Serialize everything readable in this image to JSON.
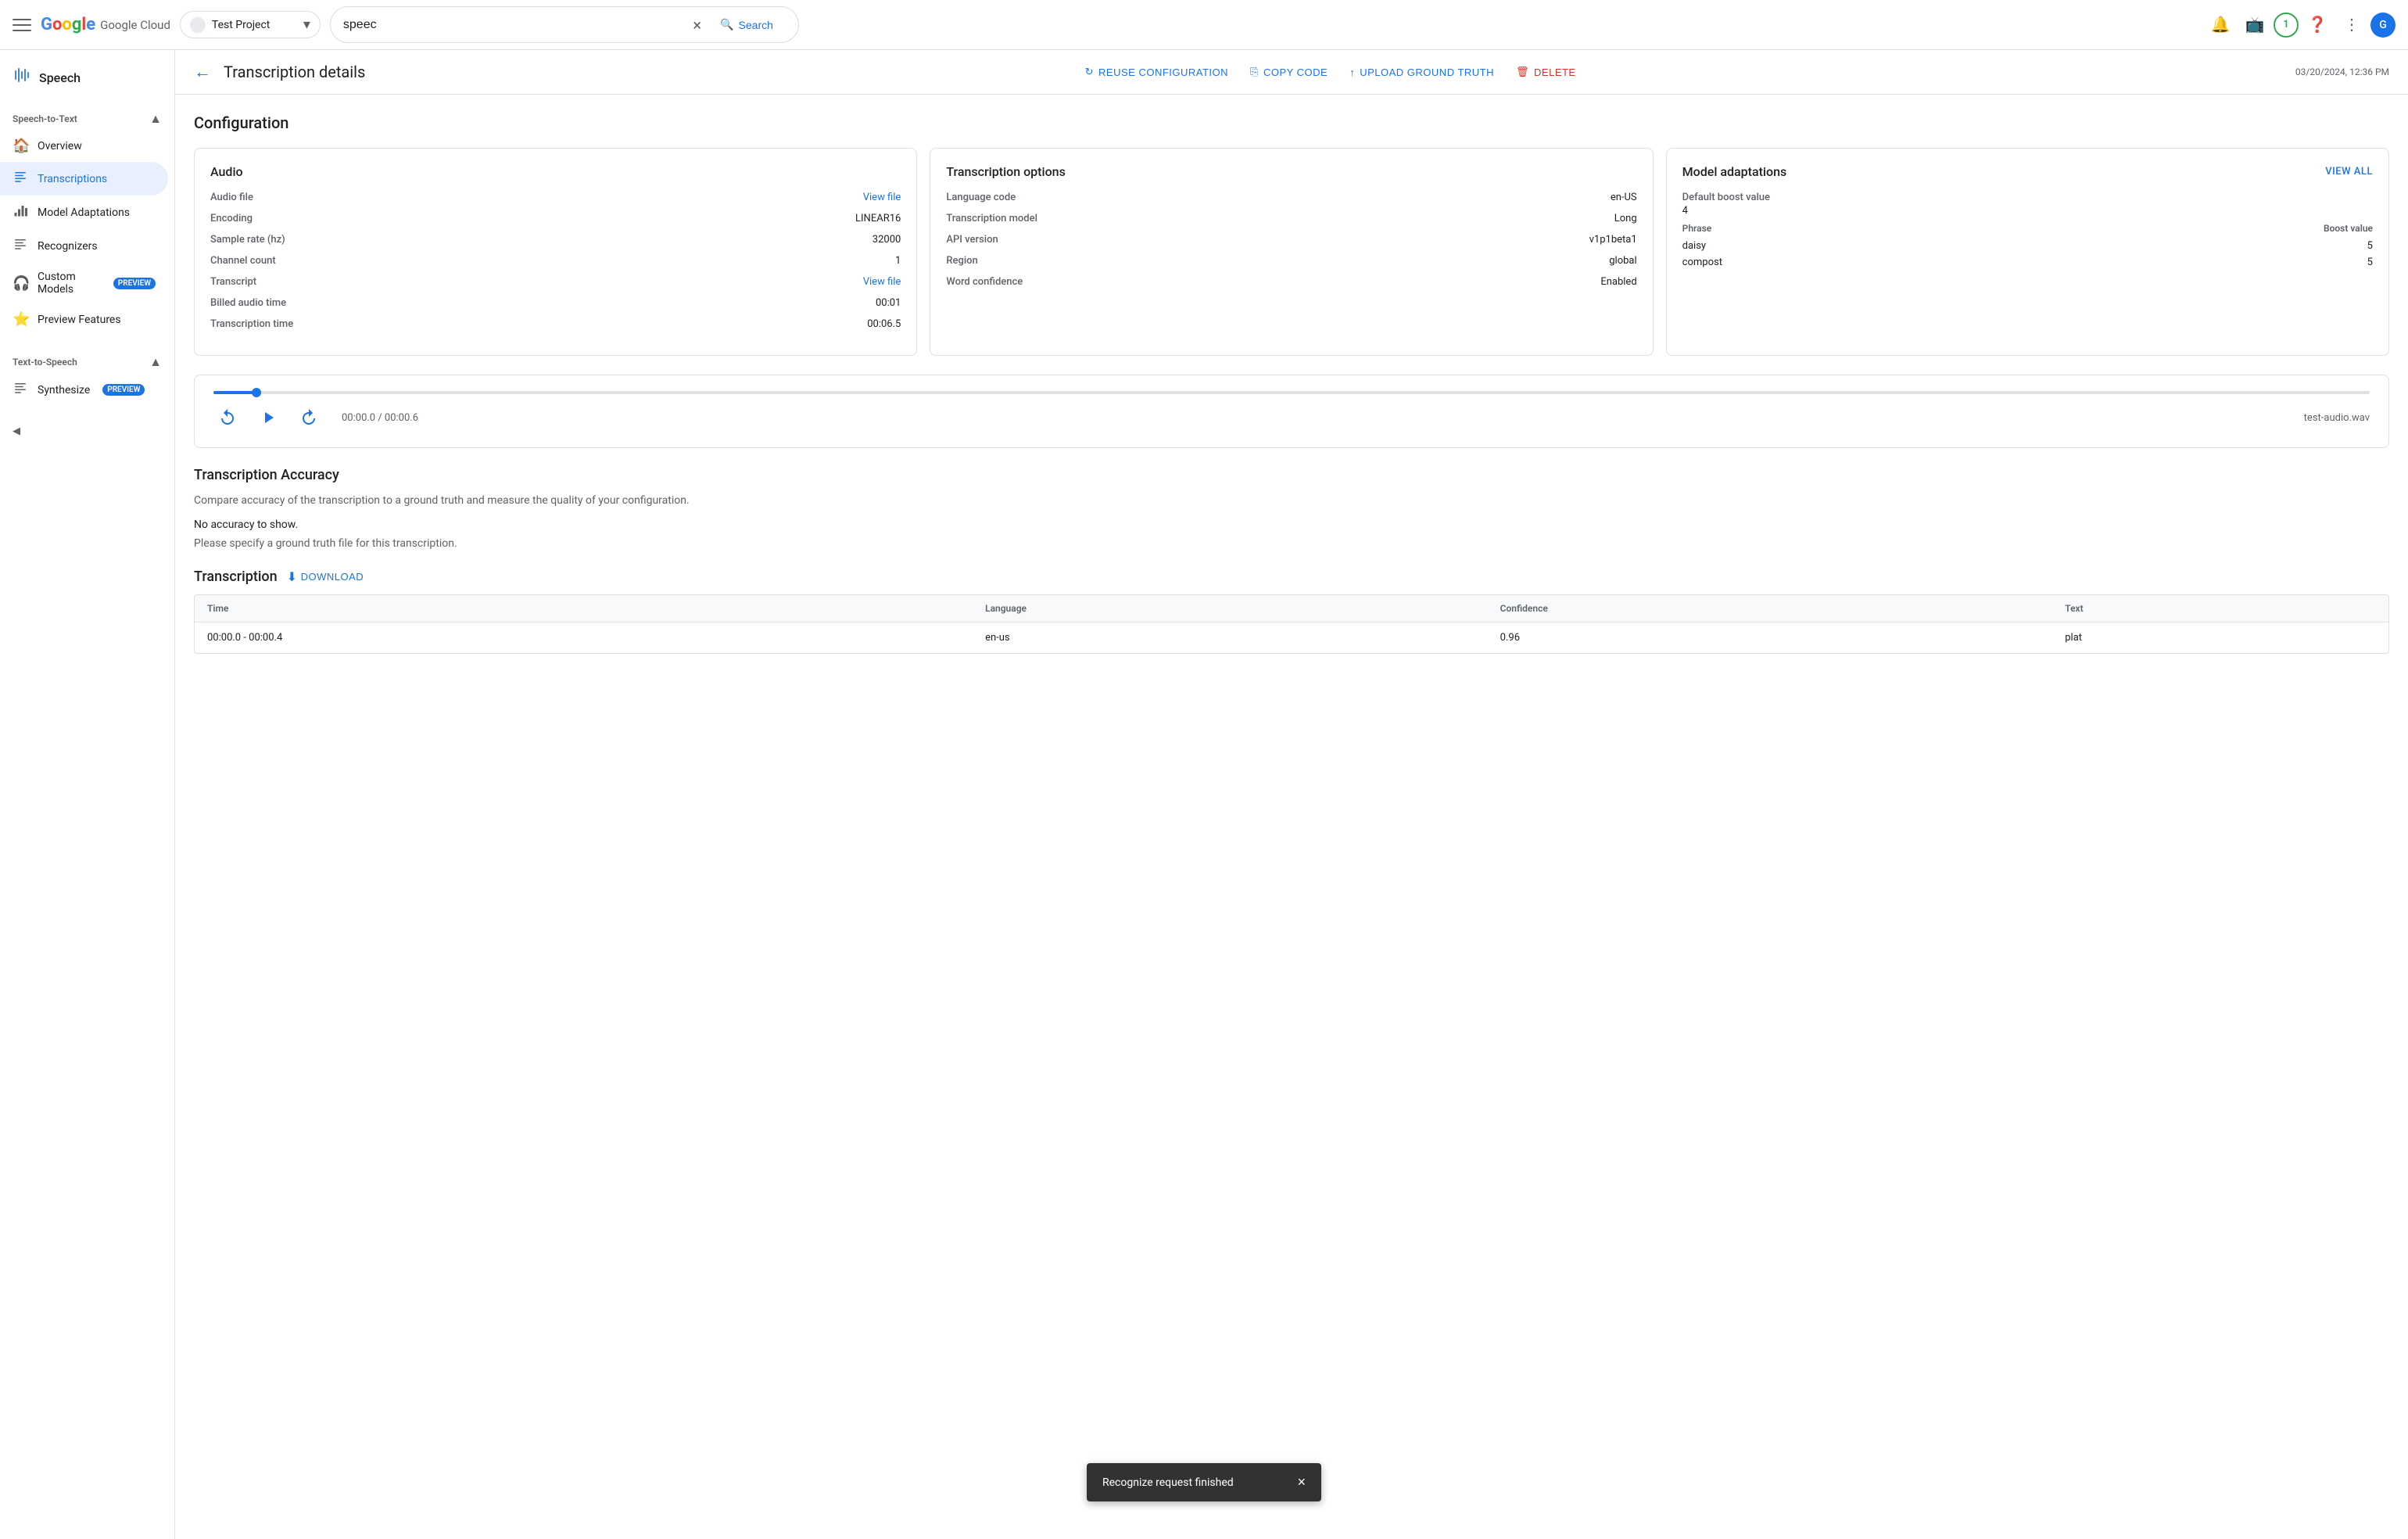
{
  "nav": {
    "hamburger_label": "Menu",
    "logo_text": "Google Cloud",
    "project_name": "Test Project",
    "search_value": "speec",
    "search_placeholder": "Search",
    "search_btn_label": "Search",
    "clear_btn": "×",
    "icons": [
      "notifications",
      "cast",
      "account_circle",
      "help",
      "more_vert"
    ],
    "count": "1",
    "avatar": "G"
  },
  "sidebar": {
    "product_name": "Speech",
    "speech_to_text_label": "Speech-to-Text",
    "items": [
      {
        "id": "overview",
        "label": "Overview",
        "icon": "🏠",
        "active": false
      },
      {
        "id": "transcriptions",
        "label": "Transcriptions",
        "icon": "☰",
        "active": true
      },
      {
        "id": "model-adaptations",
        "label": "Model Adaptations",
        "icon": "📊",
        "active": false
      },
      {
        "id": "recognizers",
        "label": "Recognizers",
        "icon": "☰",
        "active": false
      },
      {
        "id": "custom-models",
        "label": "Custom Models",
        "icon": "🎧",
        "active": false,
        "badge": "PREVIEW"
      },
      {
        "id": "preview-features",
        "label": "Preview Features",
        "icon": "⭐",
        "active": false
      }
    ],
    "text_to_speech_label": "Text-to-Speech",
    "tts_items": [
      {
        "id": "synthesize",
        "label": "Synthesize",
        "icon": "☰",
        "active": false,
        "badge": "PREVIEW"
      }
    ],
    "collapse_label": "Collapse"
  },
  "page": {
    "back_label": "←",
    "title": "Transcription details",
    "timestamp": "03/20/2024, 12:36 PM",
    "actions": [
      {
        "id": "reuse-config",
        "label": "REUSE CONFIGURATION",
        "icon": "↻",
        "color": "blue"
      },
      {
        "id": "copy-code",
        "label": "COPY CODE",
        "icon": "⎘",
        "color": "blue"
      },
      {
        "id": "upload-ground-truth",
        "label": "UPLOAD GROUND TRUTH",
        "icon": "↑",
        "color": "blue"
      },
      {
        "id": "delete",
        "label": "DELETE",
        "icon": "🗑",
        "color": "red"
      }
    ]
  },
  "configuration": {
    "title": "Configuration",
    "audio_card": {
      "title": "Audio",
      "rows": [
        {
          "label": "Audio file",
          "value": "View file",
          "is_link": true
        },
        {
          "label": "Encoding",
          "value": "LINEAR16"
        },
        {
          "label": "Sample rate (hz)",
          "value": "32000"
        },
        {
          "label": "Channel count",
          "value": "1"
        },
        {
          "label": "Transcript",
          "value": "View file",
          "is_link": true
        },
        {
          "label": "Billed audio time",
          "value": "00:01"
        },
        {
          "label": "Transcription time",
          "value": "00:06.5"
        }
      ]
    },
    "transcription_options_card": {
      "title": "Transcription options",
      "rows": [
        {
          "label": "Language code",
          "value": "en-US"
        },
        {
          "label": "Transcription model",
          "value": "Long"
        },
        {
          "label": "API version",
          "value": "v1p1beta1"
        },
        {
          "label": "Region",
          "value": "global"
        },
        {
          "label": "Word confidence",
          "value": "Enabled"
        }
      ]
    },
    "model_adaptations_card": {
      "title": "Model adaptations",
      "view_all_label": "VIEW ALL",
      "default_boost_label": "Default boost value",
      "default_boost_value": "4",
      "phrase_label": "Phrase",
      "boost_label": "Boost value",
      "phrases": [
        {
          "phrase": "daisy",
          "boost": "5"
        },
        {
          "phrase": "compost",
          "boost": "5"
        }
      ]
    }
  },
  "audio_player": {
    "filename": "test-audio.wav",
    "current_time": "00:00.0",
    "total_time": "00:00.6",
    "time_display": "00:00.0 / 00:00.6",
    "progress_percent": 2
  },
  "transcription_accuracy": {
    "title": "Transcription Accuracy",
    "description": "Compare accuracy of the transcription to a ground truth and measure the quality of your configuration.",
    "no_accuracy_text": "No accuracy to show.",
    "hint_text": "Please specify a ground truth file for this transcription."
  },
  "transcription_table": {
    "title": "Transcription",
    "download_label": "DOWNLOAD",
    "columns": [
      "Time",
      "Language",
      "Confidence",
      "Text"
    ],
    "rows": [
      {
        "time": "00:00.0 - 00:00.4",
        "language": "en-us",
        "confidence": "0.96",
        "text": "plat"
      }
    ]
  },
  "snackbar": {
    "message": "Recognize request finished",
    "close_label": "×"
  }
}
